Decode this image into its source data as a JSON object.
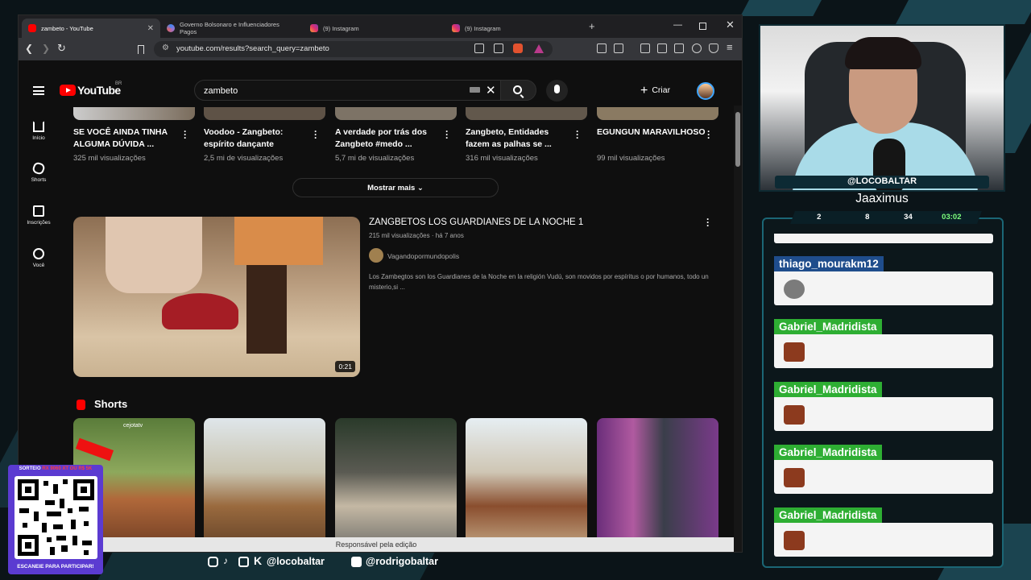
{
  "browser": {
    "tabs": [
      {
        "label": "zambeto - YouTube",
        "favicon": "youtube"
      },
      {
        "label": "Governo Bolsonaro e Influenciadores Pagos",
        "favicon": "gemini"
      },
      {
        "label": "(9) Instagram",
        "favicon": "instagram"
      },
      {
        "label": "(9) Instagram",
        "favicon": "instagram"
      }
    ],
    "url": "youtube.com/results?search_query=zambeto"
  },
  "youtube": {
    "logo": "YouTube",
    "country": "BR",
    "search_value": "zambeto",
    "create_label": "Criar",
    "nav": [
      {
        "label": "Início",
        "icon": "home-icon"
      },
      {
        "label": "Shorts",
        "icon": "shorts-icon"
      },
      {
        "label": "Inscrições",
        "icon": "subscriptions-icon"
      },
      {
        "label": "Você",
        "icon": "you-icon"
      }
    ],
    "top_cards": [
      {
        "title": "SE VOCÊ AINDA TINHA ALGUMA DÚVIDA ...",
        "views": "325 mil visualizações"
      },
      {
        "title": "Voodoo - Zangbeto: espírito dançante",
        "views": "2,5 mi de visualizações"
      },
      {
        "title": "A verdade por trás dos Zangbeto #medo ...",
        "views": "5,7 mi de visualizações"
      },
      {
        "title": "Zangbeto, Entidades fazem as palhas se ...",
        "views": "316 mil visualizações"
      },
      {
        "title": "EGUNGUN MARAVILHOSO",
        "views": "99 mil visualizações"
      }
    ],
    "show_more": "Mostrar mais",
    "video": {
      "title": "ZANGBETOS LOS GUARDIANES DE LA NOCHE 1",
      "meta": "215 mil visualizações · há 7 anos",
      "channel": "Vagandopormundopolis",
      "description": "Los Zambegtos son los Guardianes de la Noche en la religión Vudú, son movidos por espíritus o por humanos, todo un misterio,si ...",
      "duration": "0:21"
    },
    "shorts_heading": "Shorts",
    "shorts_watermark": "cejotatv",
    "status_bar": "Responsável pela edição"
  },
  "stream": {
    "handle": "@LOCOBALTAR",
    "streamer": "Jaaximus",
    "stats": [
      "2",
      "8",
      "34",
      "03:02"
    ],
    "chat": [
      {
        "user": "thiago_mourakm12",
        "color": "#1f4d8c"
      },
      {
        "user": "Gabriel_Madridista",
        "color": "#2eae33"
      },
      {
        "user": "Gabriel_Madridista",
        "color": "#2eae33"
      },
      {
        "user": "Gabriel_Madridista",
        "color": "#2eae33"
      },
      {
        "user": "Gabriel_Madridista",
        "color": "#2eae33"
      }
    ],
    "raffle_top_prefix": "SORTEIO ",
    "raffle_top_highlight": "RX 9060 XT OU R$ 5K",
    "raffle_bottom": "ESCANEIE PARA PARTICIPAR!",
    "social": [
      "@locobaltar",
      "@rodrigobaltar"
    ]
  }
}
